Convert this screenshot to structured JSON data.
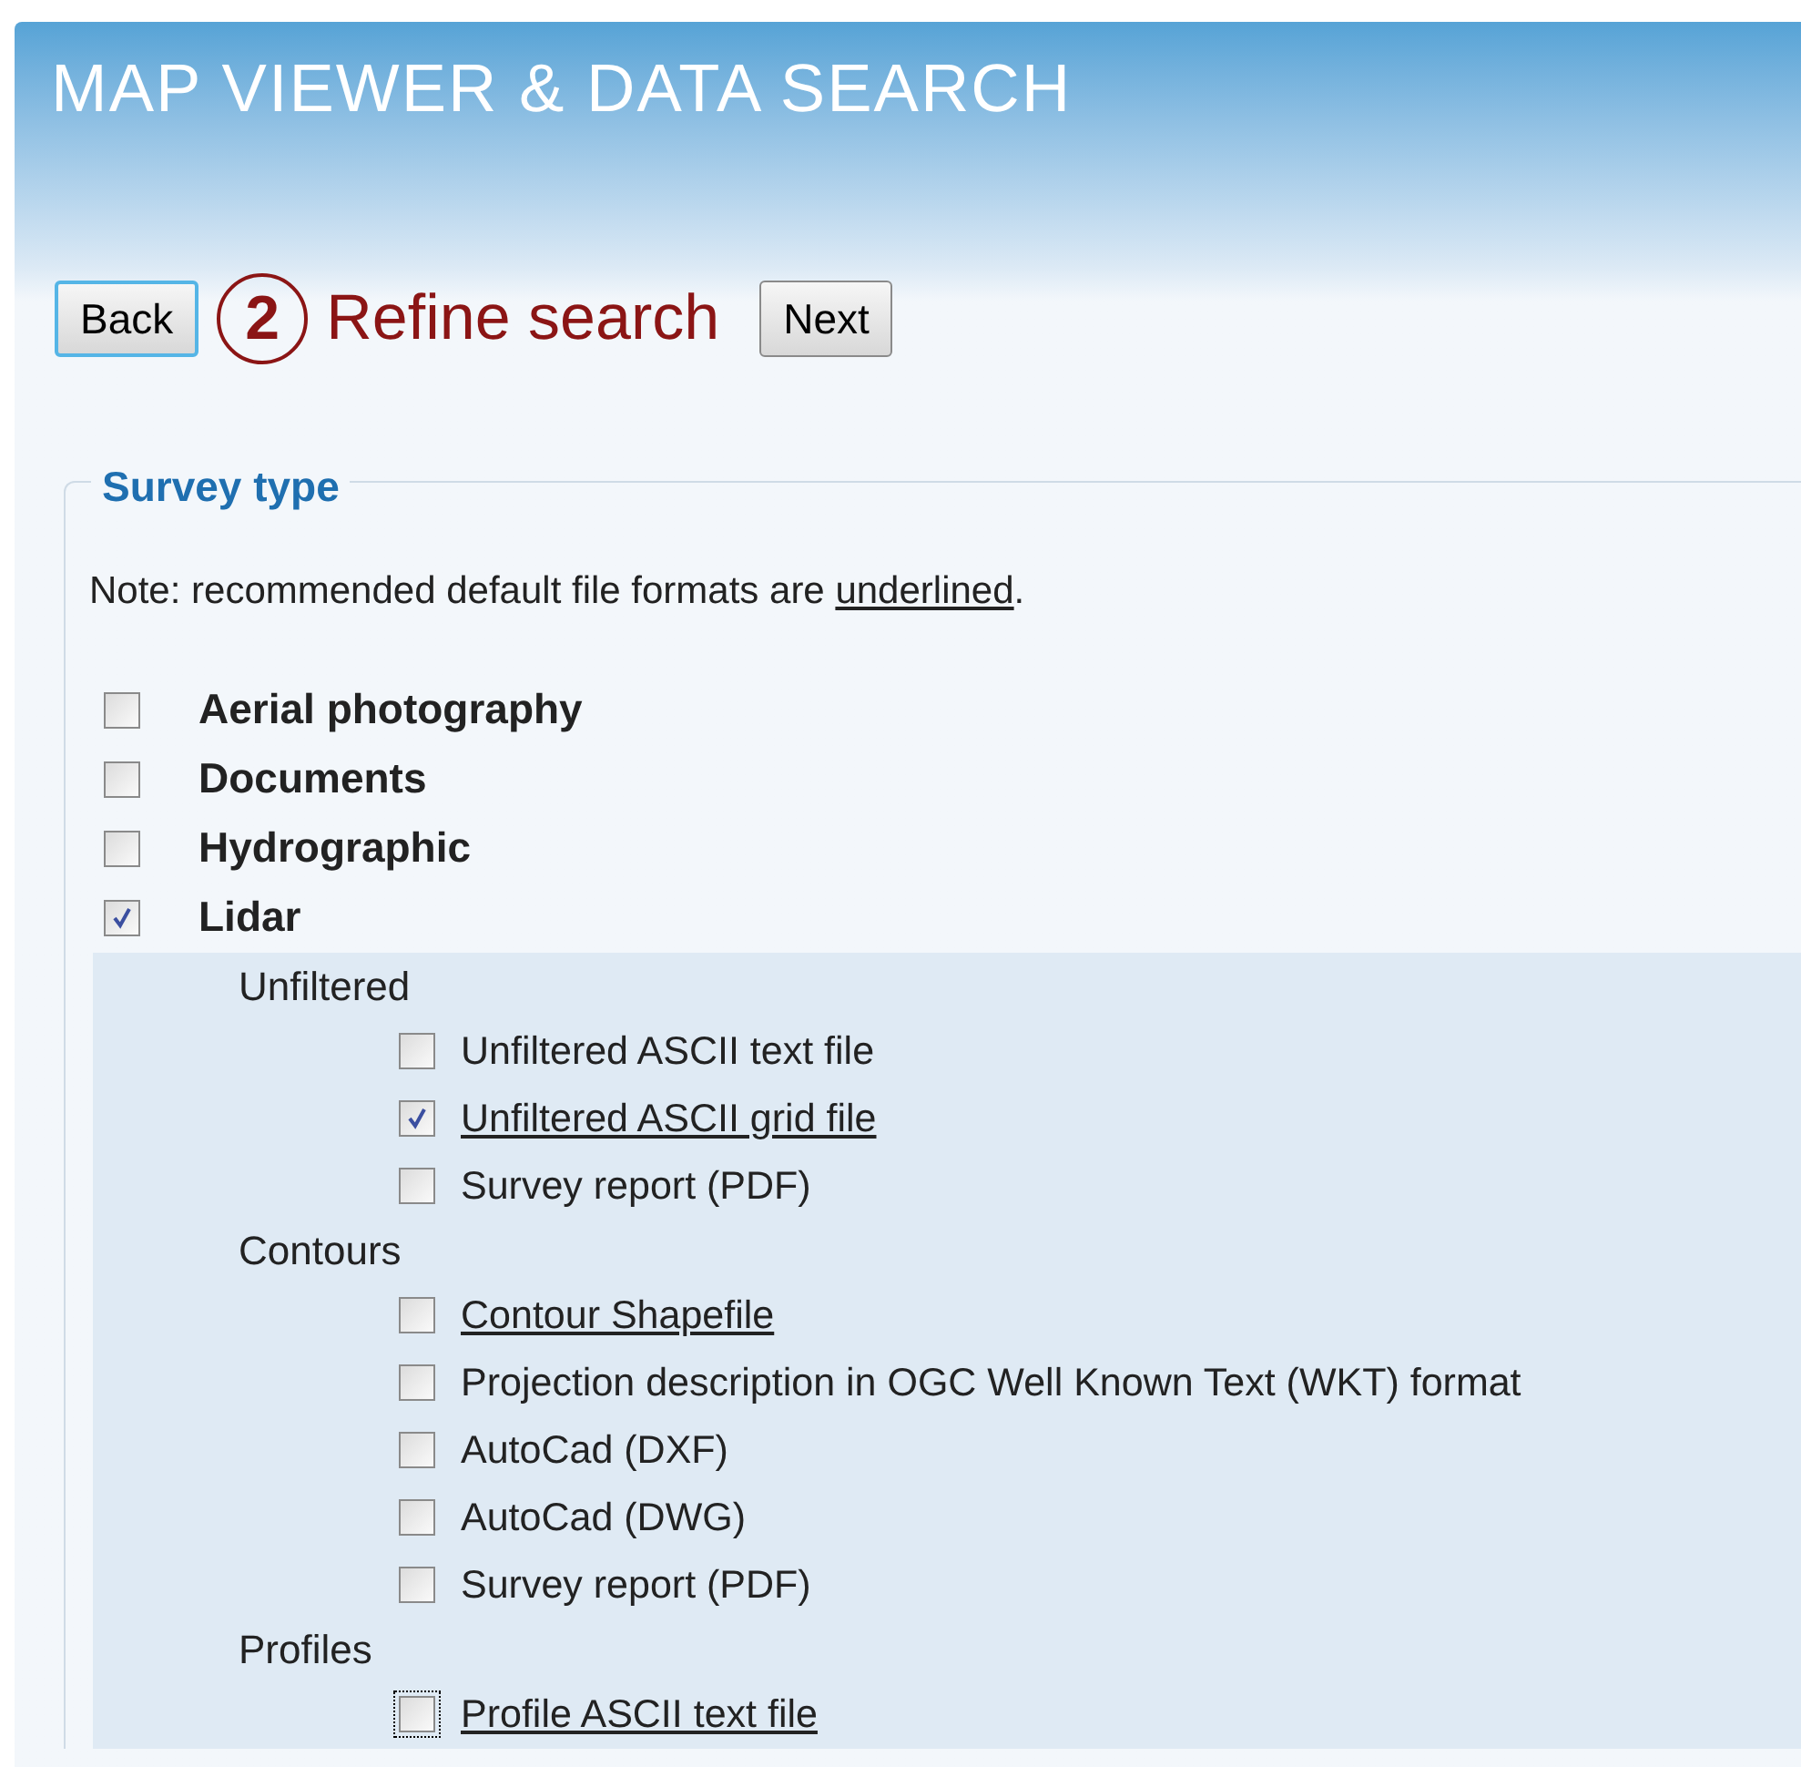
{
  "header": {
    "title": "MAP VIEWER & DATA SEARCH"
  },
  "nav": {
    "back": "Back",
    "step_number": "2",
    "step_title": "Refine search",
    "next": "Next"
  },
  "fieldset": {
    "legend": "Survey type",
    "note_before": "Note: recommended default file formats are ",
    "note_underlined": "underlined",
    "note_after": ".",
    "survey_types": [
      {
        "label": "Aerial photography",
        "checked": false
      },
      {
        "label": "Documents",
        "checked": false
      },
      {
        "label": "Hydrographic",
        "checked": false
      },
      {
        "label": "Lidar",
        "checked": true,
        "children": [
          {
            "label": "Unfiltered",
            "items": [
              {
                "label": "Unfiltered ASCII text file",
                "checked": false,
                "recommended": false,
                "focused": false
              },
              {
                "label": "Unfiltered ASCII grid file",
                "checked": true,
                "recommended": true,
                "focused": false
              },
              {
                "label": "Survey report (PDF)",
                "checked": false,
                "recommended": false,
                "focused": false
              }
            ]
          },
          {
            "label": "Contours",
            "items": [
              {
                "label": "Contour Shapefile",
                "checked": false,
                "recommended": true,
                "focused": false
              },
              {
                "label": "Projection description in OGC Well Known Text (WKT) format",
                "checked": false,
                "recommended": false,
                "focused": false
              },
              {
                "label": "AutoCad (DXF)",
                "checked": false,
                "recommended": false,
                "focused": false
              },
              {
                "label": "AutoCad (DWG)",
                "checked": false,
                "recommended": false,
                "focused": false
              },
              {
                "label": "Survey report (PDF)",
                "checked": false,
                "recommended": false,
                "focused": false
              }
            ]
          },
          {
            "label": "Profiles",
            "items": [
              {
                "label": "Profile ASCII text file",
                "checked": false,
                "recommended": true,
                "focused": true
              }
            ]
          }
        ]
      }
    ]
  }
}
